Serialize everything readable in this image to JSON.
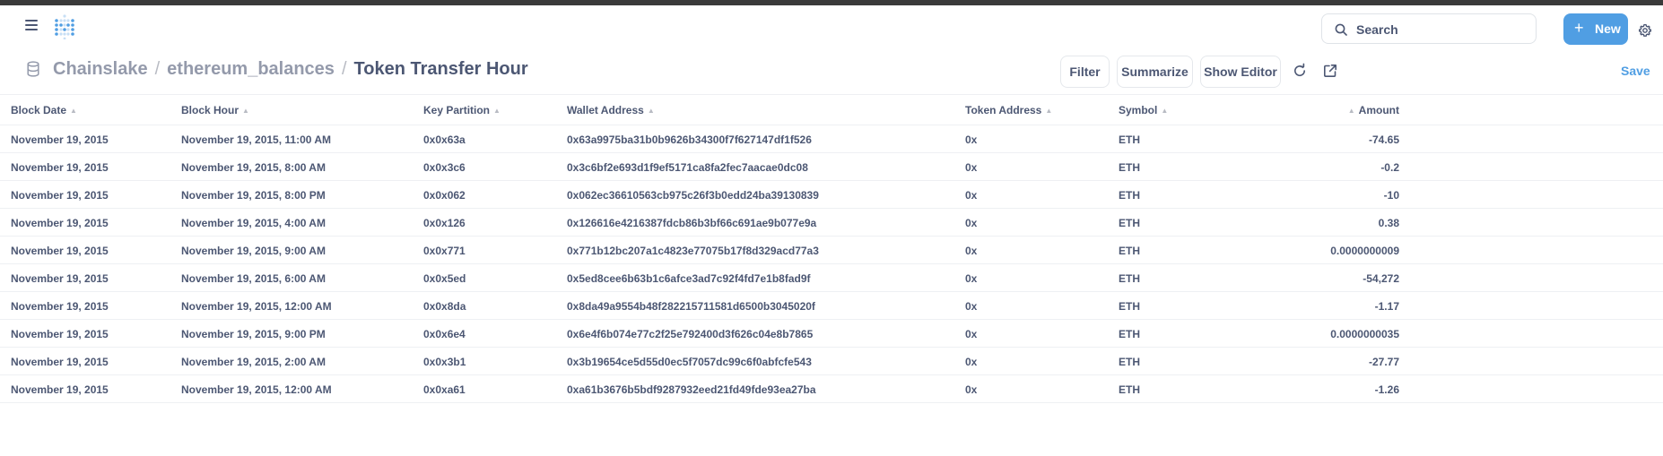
{
  "nav": {
    "search_placeholder": "Search",
    "new_plus": "+",
    "new_label": "New",
    "accent_color": "#509ee3"
  },
  "header": {
    "breadcrumb": [
      "Chainslake",
      "ethereum_balances",
      "Token Transfer Hour"
    ],
    "separator": "/",
    "buttons": {
      "filter": "Filter",
      "summarize": "Summarize",
      "show_editor": "Show Editor",
      "save": "Save"
    },
    "icons": [
      "database-icon",
      "refresh-icon",
      "external-link-icon",
      "gear-icon",
      "search-icon",
      "menu-icon"
    ]
  },
  "table": {
    "columns": [
      "Block Date",
      "Block Hour",
      "Key Partition",
      "Wallet Address",
      "Token Address",
      "Symbol",
      "Amount"
    ],
    "rows": [
      [
        "November 19, 2015",
        "November 19, 2015, 11:00 AM",
        "0x0x63a",
        "0x63a9975ba31b0b9626b34300f7f627147df1f526",
        "0x",
        "ETH",
        "-74.65"
      ],
      [
        "November 19, 2015",
        "November 19, 2015, 8:00 AM",
        "0x0x3c6",
        "0x3c6bf2e693d1f9ef5171ca8fa2fec7aacae0dc08",
        "0x",
        "ETH",
        "-0.2"
      ],
      [
        "November 19, 2015",
        "November 19, 2015, 8:00 PM",
        "0x0x062",
        "0x062ec36610563cb975c26f3b0edd24ba39130839",
        "0x",
        "ETH",
        "-10"
      ],
      [
        "November 19, 2015",
        "November 19, 2015, 4:00 AM",
        "0x0x126",
        "0x126616e4216387fdcb86b3bf66c691ae9b077e9a",
        "0x",
        "ETH",
        "0.38"
      ],
      [
        "November 19, 2015",
        "November 19, 2015, 9:00 AM",
        "0x0x771",
        "0x771b12bc207a1c4823e77075b17f8d329acd77a3",
        "0x",
        "ETH",
        "0.0000000009"
      ],
      [
        "November 19, 2015",
        "November 19, 2015, 6:00 AM",
        "0x0x5ed",
        "0x5ed8cee6b63b1c6afce3ad7c92f4fd7e1b8fad9f",
        "0x",
        "ETH",
        "-54,272"
      ],
      [
        "November 19, 2015",
        "November 19, 2015, 12:00 AM",
        "0x0x8da",
        "0x8da49a9554b48f282215711581d6500b3045020f",
        "0x",
        "ETH",
        "-1.17"
      ],
      [
        "November 19, 2015",
        "November 19, 2015, 9:00 PM",
        "0x0x6e4",
        "0x6e4f6b074e77c2f25e792400d3f626c04e8b7865",
        "0x",
        "ETH",
        "0.0000000035"
      ],
      [
        "November 19, 2015",
        "November 19, 2015, 2:00 AM",
        "0x0x3b1",
        "0x3b19654ce5d55d0ec5f7057dc99c6f0abfcfe543",
        "0x",
        "ETH",
        "-27.77"
      ],
      [
        "November 19, 2015",
        "November 19, 2015, 12:00 AM",
        "0x0xa61",
        "0xa61b3676b5bdf9287932eed21fd49fde93ea27ba",
        "0x",
        "ETH",
        "-1.26"
      ]
    ]
  }
}
